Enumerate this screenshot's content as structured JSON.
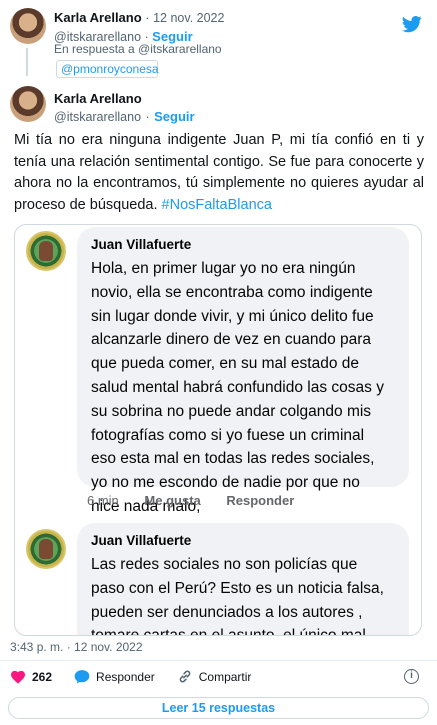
{
  "parent_tweet": {
    "author_name": "Karla Arellano",
    "separator": "·",
    "date": "12 nov. 2022",
    "handle": "@itskararellano",
    "follow_label": "Seguir",
    "reply_to_text": "En respuesta a @itskararellano",
    "mentioned_handle": "@pmonroyconesa"
  },
  "main_tweet": {
    "author_name": "Karla Arellano",
    "handle": "@itskararellano",
    "follow_label": "Seguir",
    "body": "Mi tía no era ninguna indigente Juan P, mi tía confió en ti y tenía una relación sentimental contigo. Se fue para conocerte y ahora no la encontramos, tú simplemente no quieres ayudar al proceso de búsqueda.",
    "hashtag": "#NosFaltaBlanca",
    "timestamp": "3:43 p. m. · 12 nov. 2022",
    "like_count": "262",
    "reply_label": "Responder",
    "share_label": "Compartir",
    "read_replies_label": "Leer 15 respuestas",
    "info_glyph": "i"
  },
  "embedded_comments": [
    {
      "author": "Juan Villafuerte",
      "text": "Hola, en primer lugar yo no era ningún\nnovio, ella se encontraba como indigente\nsin lugar donde vivir, y mi único delito fue\nalcanzarle dinero de vez en cuando para\nque pueda comer, en su mal estado de\nsalud mental habrá confundido las cosas y\nsu sobrina no puede andar colgando mis\nfotografías como si yo fuese un criminal\neso esta mal en todas las redes sociales,\nyo no me escondo de nadie por que no\nhice nada malo,",
      "time": "6 min",
      "like_label": "Me gusta",
      "reply_label": "Responder"
    },
    {
      "author": "Juan Villafuerte",
      "text": "Las redes sociales no son policías que\npaso con el Perú? Esto es un noticia falsa,\npueden ser denunciados a los autores ,\ntomare cartas en el asunto, el único mal"
    }
  ],
  "colors": {
    "twitter_blue": "#1d9bf0",
    "like_red": "#f91880",
    "bubble_gray": "#f0f2f5",
    "muted_text": "#536471"
  },
  "icons": [
    "twitter-logo-icon",
    "heart-icon",
    "reply-bubble-icon",
    "share-link-icon",
    "info-icon"
  ]
}
